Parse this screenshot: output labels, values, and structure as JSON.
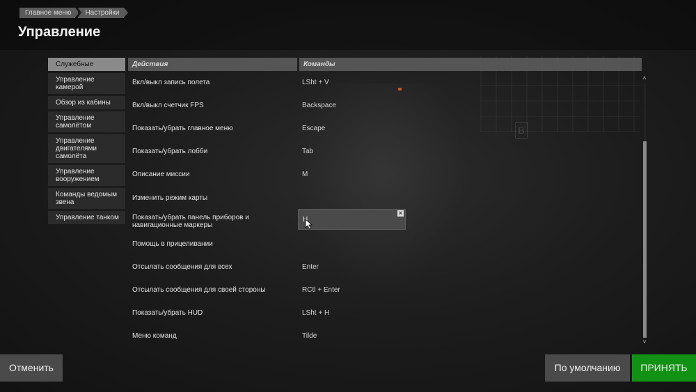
{
  "breadcrumb": [
    "Главное меню",
    "Настройки"
  ],
  "title": "Управление",
  "sidebar": {
    "items": [
      {
        "label": "Служебные",
        "active": true
      },
      {
        "label": "Управление камерой",
        "active": false
      },
      {
        "label": "Обзор из кабины",
        "active": false
      },
      {
        "label": "Управление самолётом",
        "active": false
      },
      {
        "label": "Управление двигателями самолёта",
        "active": false
      },
      {
        "label": "Управление вооружением",
        "active": false
      },
      {
        "label": "Команды ведомым звена",
        "active": false
      },
      {
        "label": "Управление танком",
        "active": false
      }
    ]
  },
  "table": {
    "headers": {
      "actions": "Действия",
      "commands": "Команды"
    },
    "rows": [
      {
        "action": "Вкл/выкл запись полета",
        "key": "LSht + V"
      },
      {
        "action": "Вкл/выкл счетчик FPS",
        "key": "Backspace"
      },
      {
        "action": "Показать/убрать главное меню",
        "key": "Escape"
      },
      {
        "action": "Показать/убрать лобби",
        "key": "Tab"
      },
      {
        "action": "Описание миссии",
        "key": "M"
      },
      {
        "action": "Изменить режим карты",
        "key": ""
      },
      {
        "action": "Показать/убрать панель приборов и навигационные маркеры",
        "key": ""
      },
      {
        "action": "Помощь в прицеливании",
        "key": ""
      },
      {
        "action": "Отсылать сообщения для всех",
        "key": "Enter"
      },
      {
        "action": "Отсылать сообщения для своей стороны",
        "key": "RCtl + Enter"
      },
      {
        "action": "Показать/убрать HUD",
        "key": "LSht + H"
      },
      {
        "action": "Меню команд",
        "key": "Tilde"
      }
    ]
  },
  "editing": {
    "value": "H",
    "close_icon": "×"
  },
  "scroll": {
    "up_icon": "˄",
    "down_icon": "˅"
  },
  "buttons": {
    "cancel": "Отменить",
    "default": "По умолчанию",
    "accept": "ПРИНЯТЬ"
  },
  "colors": {
    "accept": "#129214",
    "active_tab": "#8a8a8a"
  }
}
